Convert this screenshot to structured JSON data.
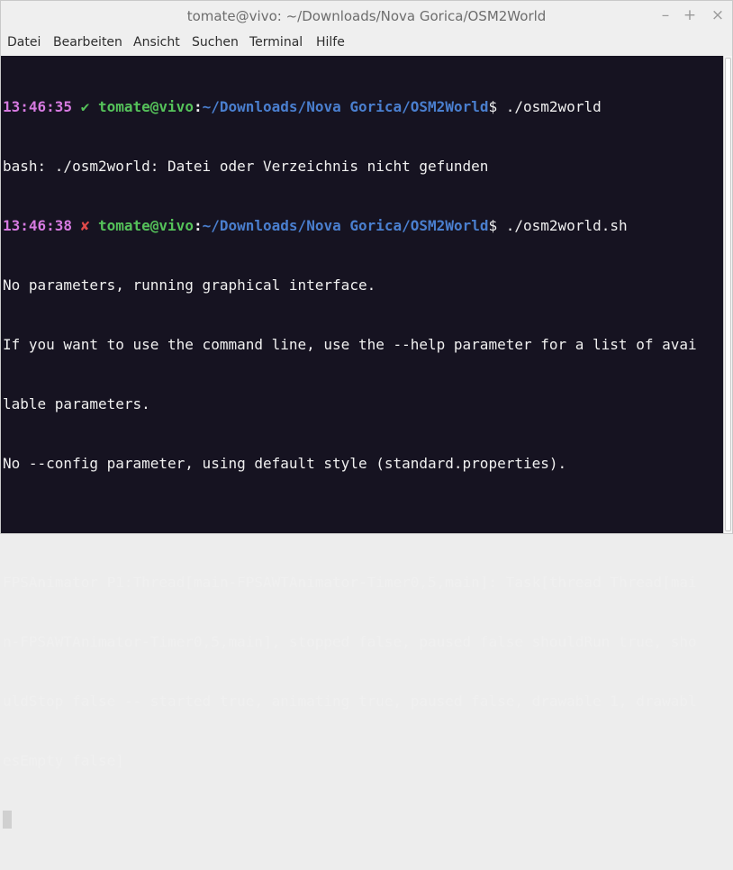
{
  "window": {
    "title": "tomate@vivo: ~/Downloads/Nova Gorica/OSM2World",
    "minimize": "–",
    "maximize": "+",
    "close": "×"
  },
  "menu": {
    "items": [
      "Datei",
      "Bearbeiten",
      "Ansicht",
      "Suchen",
      "Terminal",
      "Hilfe"
    ]
  },
  "terminal": {
    "prompt1": {
      "time": "13:46:35",
      "status": "✔",
      "user": "tomate@vivo",
      "colon": ":",
      "path": "~/Downloads/Nova Gorica/OSM2World",
      "command": "$ ./osm2world"
    },
    "out1": "bash: ./osm2world: Datei oder Verzeichnis nicht gefunden",
    "prompt2": {
      "time": "13:46:38",
      "status": "✘",
      "user": "tomate@vivo",
      "colon": ":",
      "path": "~/Downloads/Nova Gorica/OSM2World",
      "command": "$ ./osm2world.sh"
    },
    "lines": [
      "No parameters, running graphical interface.",
      "If you want to use the command line, use the --help parameter for a list of avai",
      "lable parameters.",
      "No --config parameter, using default style (standard.properties).",
      "",
      "FPSAnimator P1:Thread[main-FPSAWTAnimator-Timer0,5,main]: Task[thread Thread[mai",
      "n-FPSAWTAnimator-Timer0,5,main], stopped false, paused false shouldRun true, sho",
      "uldStop false -- started true, animating true, paused false, drawable 1, drawabl",
      "esEmpty false]"
    ]
  }
}
